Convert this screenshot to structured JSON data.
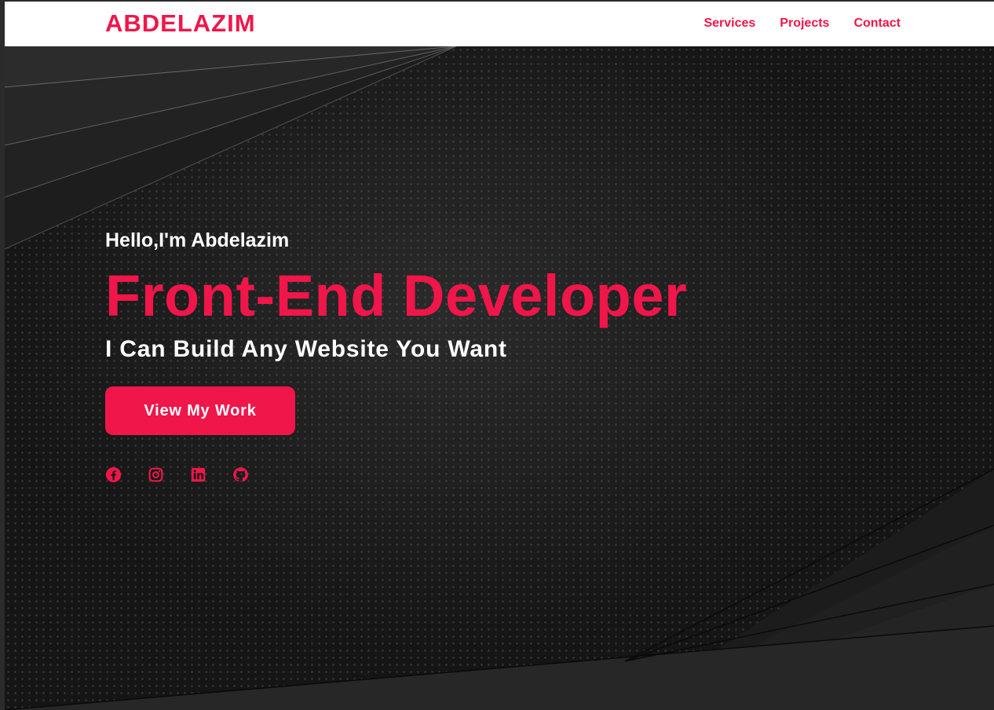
{
  "navbar": {
    "brand": "ABDELAZIM",
    "links": [
      "Services",
      "Projects",
      "Contact"
    ]
  },
  "hero": {
    "greeting": "Hello,I'm Abdelazim",
    "role": "Front-End Developer",
    "tagline": "I Can Build Any Website You Want",
    "cta_label": "View My Work",
    "socials": [
      "facebook-icon",
      "instagram-icon",
      "linkedin-icon",
      "github-icon"
    ]
  },
  "colors": {
    "accent": "#f0164a",
    "navbar_bg": "#ffffff",
    "hero_bg": "#151515",
    "text_light": "#ffffff"
  }
}
